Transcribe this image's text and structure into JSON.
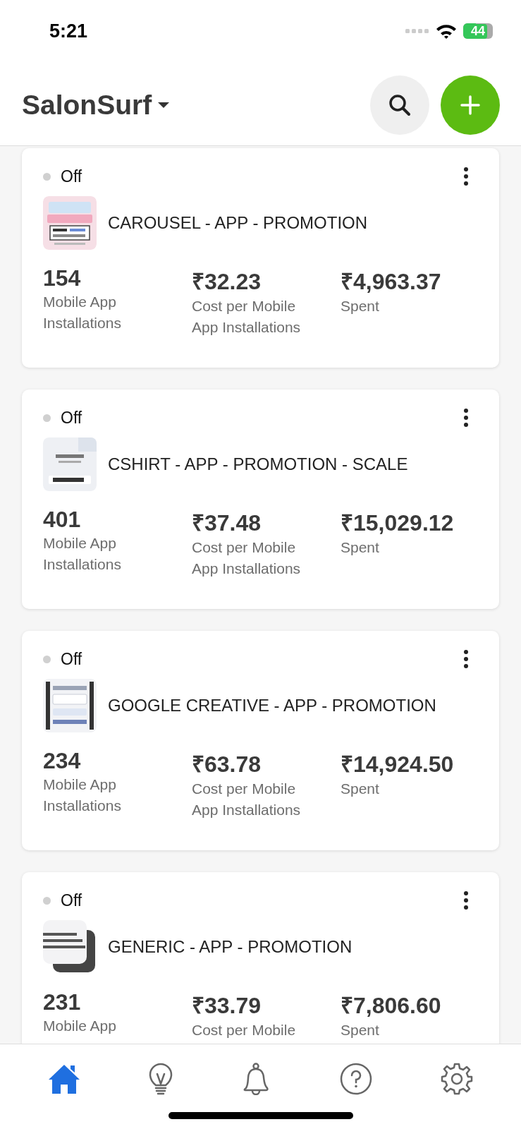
{
  "status_bar": {
    "time": "5:21",
    "battery": "44"
  },
  "header": {
    "account": "SalonSurf"
  },
  "campaigns": [
    {
      "status": "Off",
      "on": false,
      "name": "CAROUSEL - APP - PROMOTION",
      "thumb": {
        "kind": "picture"
      },
      "metrics": [
        {
          "value": "154",
          "label": "Mobile App Installations"
        },
        {
          "value": "₹32.23",
          "label": "Cost per Mobile App Installations"
        },
        {
          "value": "₹4,963.37",
          "label": "Spent"
        }
      ]
    },
    {
      "status": "Off",
      "on": false,
      "name": "CSHIRT - APP - PROMOTION - SCALE",
      "thumb": {
        "kind": "picture"
      },
      "metrics": [
        {
          "value": "401",
          "label": "Mobile App Installations"
        },
        {
          "value": "₹37.48",
          "label": "Cost per Mobile App Installations"
        },
        {
          "value": "₹15,029.12",
          "label": "Spent"
        }
      ]
    },
    {
      "status": "Off",
      "on": false,
      "name": "GOOGLE CREATIVE - APP - PROMOTION",
      "thumb": {
        "kind": "picture"
      },
      "metrics": [
        {
          "value": "234",
          "label": "Mobile App Installations"
        },
        {
          "value": "₹63.78",
          "label": "Cost per Mobile App Installations"
        },
        {
          "value": "₹14,924.50",
          "label": "Spent"
        }
      ]
    },
    {
      "status": "Off",
      "on": false,
      "name": "GENERIC - APP - PROMOTION",
      "thumb": {
        "kind": "picture"
      },
      "metrics": [
        {
          "value": "231",
          "label": "Mobile App"
        },
        {
          "value": "₹33.79",
          "label": "Cost per Mobile"
        },
        {
          "value": "₹7,806.60",
          "label": "Spent"
        }
      ]
    }
  ],
  "tabs": [
    {
      "kind": "home",
      "selected": true
    },
    {
      "kind": "ideas",
      "selected": false
    },
    {
      "kind": "alerts",
      "selected": false
    },
    {
      "kind": "help",
      "selected": false
    },
    {
      "kind": "settings",
      "selected": false
    }
  ]
}
